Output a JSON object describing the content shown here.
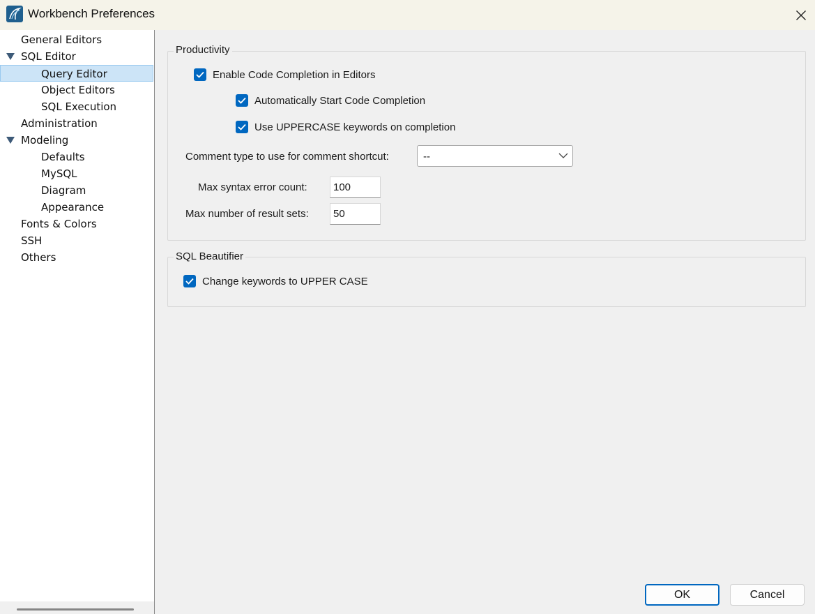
{
  "window": {
    "title": "Workbench Preferences"
  },
  "sidebar": {
    "items": [
      {
        "label": "General Editors"
      },
      {
        "label": "SQL Editor"
      },
      {
        "label": "Query Editor"
      },
      {
        "label": "Object Editors"
      },
      {
        "label": "SQL Execution"
      },
      {
        "label": "Administration"
      },
      {
        "label": "Modeling"
      },
      {
        "label": "Defaults"
      },
      {
        "label": "MySQL"
      },
      {
        "label": "Diagram"
      },
      {
        "label": "Appearance"
      },
      {
        "label": "Fonts & Colors"
      },
      {
        "label": "SSH"
      },
      {
        "label": "Others"
      }
    ],
    "selected": "Query Editor"
  },
  "productivity": {
    "title": "Productivity",
    "enable_code_completion": {
      "label": "Enable Code Completion in Editors",
      "checked": true
    },
    "auto_start_completion": {
      "label": "Automatically Start Code Completion",
      "checked": true
    },
    "uppercase_keywords": {
      "label": "Use UPPERCASE keywords on completion",
      "checked": true
    },
    "comment_type": {
      "label": "Comment type to use for comment shortcut:",
      "value": "--"
    },
    "max_syntax_errors": {
      "label": "Max syntax error count:",
      "value": "100"
    },
    "max_result_sets": {
      "label": "Max number of result sets:",
      "value": "50"
    }
  },
  "beautifier": {
    "title": "SQL Beautifier",
    "change_keywords_upper": {
      "label": "Change keywords to UPPER CASE",
      "checked": true
    }
  },
  "buttons": {
    "ok": "OK",
    "cancel": "Cancel"
  },
  "colors": {
    "accent": "#0067c0",
    "selection": "#cce4f7"
  }
}
